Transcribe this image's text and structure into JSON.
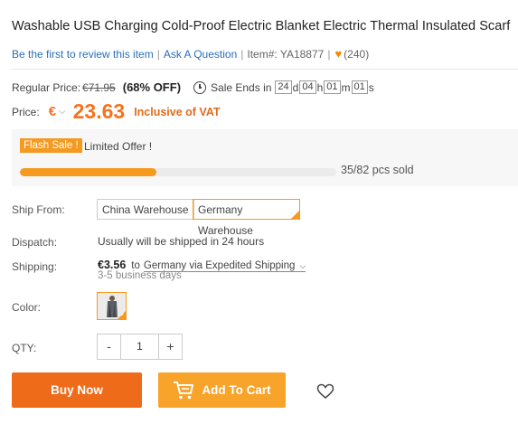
{
  "product": {
    "title": "Washable USB Charging Cold-Proof Electric Blanket Electric Thermal Insulated Scarf",
    "review_link": "Be the first to review this item",
    "ask_link": "Ask A Question",
    "item_no": "Item#: YA18877",
    "wish_count": "(240)"
  },
  "pricing": {
    "regular_label": "Regular Price:",
    "regular_price": "€71.95",
    "discount": "(68% OFF)",
    "sale_ends_label": "Sale Ends in",
    "timer": {
      "d": "24",
      "d_unit": "d",
      "h": "04",
      "h_unit": "h",
      "m": "01",
      "m_unit": "m",
      "s": "01",
      "s_unit": "s"
    },
    "price_label": "Price:",
    "currency": "€",
    "price": "23.63",
    "vat_note": "Inclusive of VAT"
  },
  "flash": {
    "tag": "Flash Sale !",
    "offer": "Limited Offer !",
    "progress": 0.43,
    "sold_text": "35/82 pcs sold"
  },
  "ship_from": {
    "label": "Ship From:",
    "options": [
      "China Warehouse",
      "Germany Warehouse"
    ],
    "selected": "Germany Warehouse"
  },
  "dispatch": {
    "label": "Dispatch:",
    "value": "Usually will be shipped in 24 hours"
  },
  "shipping": {
    "label": "Shipping:",
    "price": "€3.56",
    "to": "to",
    "method": "Germany via Expedited Shipping",
    "days": "3-5 business days"
  },
  "color": {
    "label": "Color:"
  },
  "qty": {
    "label": "QTY:",
    "minus": "-",
    "value": "1",
    "plus": "+"
  },
  "actions": {
    "buy_now": "Buy Now",
    "add_to_cart": "Add To Cart"
  },
  "colors": {
    "accent": "#f59a1f",
    "buy": "#ee6b1a",
    "cart": "#f8a32a",
    "price": "#f5731e",
    "link": "#2b6fb5"
  },
  "icons": [
    "heart-icon",
    "clock-icon",
    "chevron-down-icon",
    "cart-icon",
    "wishlist-heart-icon",
    "check-corner-icon"
  ]
}
